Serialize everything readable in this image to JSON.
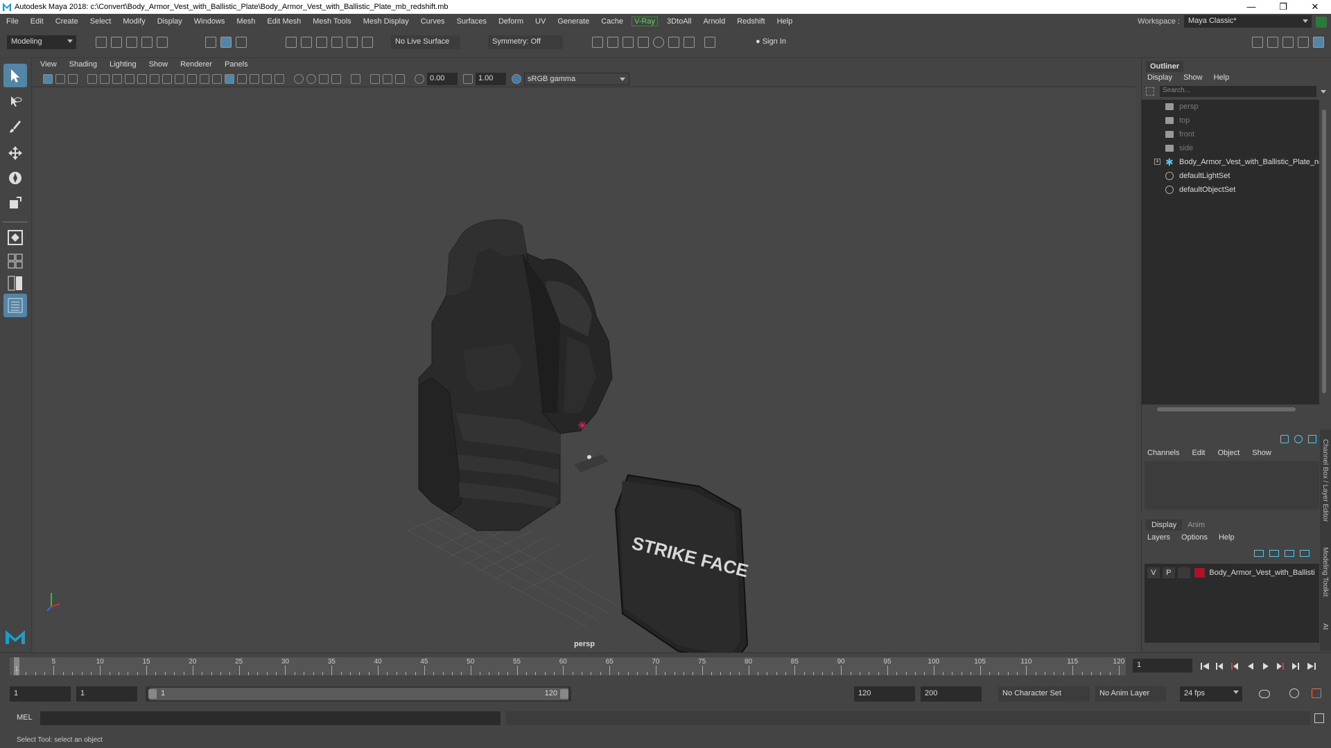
{
  "window": {
    "title": "Autodesk Maya 2018: c:\\Convert\\Body_Armor_Vest_with_Ballistic_Plate\\Body_Armor_Vest_with_Ballistic_Plate_mb_redshift.mb",
    "minimize": "—",
    "restore": "❐",
    "close": "✕"
  },
  "menubar": {
    "items": [
      "File",
      "Edit",
      "Create",
      "Select",
      "Modify",
      "Display",
      "Windows",
      "Mesh",
      "Edit Mesh",
      "Mesh Tools",
      "Mesh Display",
      "Curves",
      "Surfaces",
      "Deform",
      "UV",
      "Generate",
      "Cache",
      "V-Ray",
      "3DtoAll",
      "Arnold",
      "Redshift",
      "Help"
    ],
    "workspace_label": "Workspace :",
    "workspace_value": "Maya Classic*"
  },
  "statusline": {
    "mode": "Modeling",
    "live_surface": "No Live Surface",
    "symmetry": "Symmetry: Off",
    "sign_in": "Sign In"
  },
  "viewport": {
    "menu": [
      "View",
      "Shading",
      "Lighting",
      "Show",
      "Renderer",
      "Panels"
    ],
    "exposure": "0.00",
    "gamma": "1.00",
    "color_space": "sRGB gamma",
    "camera_label": "persp",
    "plate_text": "STRIKE FACE"
  },
  "outliner": {
    "title": "Outliner",
    "menu": [
      "Display",
      "Show",
      "Help"
    ],
    "search_placeholder": "Search...",
    "rows": [
      {
        "label": "persp",
        "icon": "camera-icon",
        "dim": true
      },
      {
        "label": "top",
        "icon": "camera-icon",
        "dim": true
      },
      {
        "label": "front",
        "icon": "camera-icon",
        "dim": true
      },
      {
        "label": "side",
        "icon": "camera-icon",
        "dim": true
      },
      {
        "label": "Body_Armor_Vest_with_Ballistic_Plate_nc",
        "icon": "mesh-group-icon",
        "dim": false
      },
      {
        "label": "defaultLightSet",
        "icon": "set-icon",
        "dim": false
      },
      {
        "label": "defaultObjectSet",
        "icon": "set-icon",
        "dim": false
      }
    ]
  },
  "channelbox": {
    "menu": [
      "Channels",
      "Edit",
      "Object",
      "Show"
    ]
  },
  "layereditor": {
    "tabs": [
      "Display",
      "Anim"
    ],
    "menu": [
      "Layers",
      "Options",
      "Help"
    ],
    "layer": {
      "v": "V",
      "p": "P",
      "name": "Body_Armor_Vest_with_Ballisti",
      "color": "#b0102a"
    }
  },
  "sidetabs": {
    "channel_box": "Channel Box / Layer Editor",
    "modeling_toolkit": "Modeling Toolkit",
    "attr": "At"
  },
  "timeslider": {
    "ticks": [
      "5",
      "10",
      "15",
      "20",
      "25",
      "30",
      "35",
      "40",
      "45",
      "50",
      "55",
      "60",
      "65",
      "70",
      "75",
      "80",
      "85",
      "90",
      "95",
      "100",
      "105",
      "110",
      "115",
      "120"
    ],
    "current_frame_marker": "1",
    "current_frame": "1",
    "range_max": 120
  },
  "rangeslider": {
    "start": "1",
    "anim_start": "1",
    "bar_start": "1",
    "bar_end": "120",
    "end": "120",
    "anim_end": "200",
    "character_set": "No Character Set",
    "anim_layer": "No Anim Layer",
    "fps": "24 fps"
  },
  "cmdline": {
    "label": "MEL"
  },
  "helpline": {
    "text": "Select Tool: select an object"
  }
}
